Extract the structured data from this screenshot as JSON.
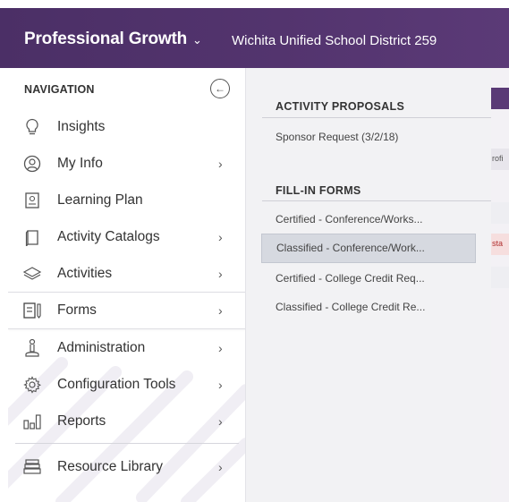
{
  "header": {
    "app_name": "Professional Growth",
    "app_chevron": "⌄",
    "district": "Wichita Unified School District 259"
  },
  "background_fragments": {
    "text1": "rofi",
    "text2": "sta"
  },
  "nav": {
    "heading": "NAVIGATION",
    "collapse_icon": "arrow-left-circle-icon",
    "items": [
      {
        "label": "Insights",
        "icon": "lightbulb-icon",
        "has_submenu": false
      },
      {
        "label": "My Info",
        "icon": "person-circle-icon",
        "has_submenu": true
      },
      {
        "label": "Learning Plan",
        "icon": "id-card-icon",
        "has_submenu": false
      },
      {
        "label": "Activity Catalogs",
        "icon": "catalog-book-icon",
        "has_submenu": true
      },
      {
        "label": "Activities",
        "icon": "layers-icon",
        "has_submenu": true
      },
      {
        "label": "Forms",
        "icon": "form-document-icon",
        "has_submenu": true,
        "active": true
      },
      {
        "label": "Administration",
        "icon": "admin-person-icon",
        "has_submenu": true
      },
      {
        "label": "Configuration Tools",
        "icon": "gear-icon",
        "has_submenu": true
      },
      {
        "label": "Reports",
        "icon": "bar-chart-icon",
        "has_submenu": true
      },
      {
        "label": "Resource Library",
        "icon": "book-stack-icon",
        "has_submenu": true
      }
    ],
    "arrow": "›"
  },
  "submenu": {
    "sections": [
      {
        "title": "ACTIVITY PROPOSALS",
        "items": [
          "Sponsor Request (3/2/18)"
        ]
      },
      {
        "title": "FILL-IN FORMS",
        "items": [
          "Certified - Conference/Workshop Request",
          "Classified - Conference/Workshop Request",
          "Certified - College Credit Request",
          "Classified - College Credit Request"
        ]
      }
    ],
    "display_items": [
      "Sponsor Request (3/2/18)",
      "Certified - Conference/Works...",
      "Classified - Conference/Work...",
      "Certified - College Credit Req...",
      "Classified - College Credit Re..."
    ],
    "highlighted_index": 2
  },
  "colors": {
    "header_bg": "#53346e",
    "submenu_bg": "#f2f2f4",
    "highlight_bg": "#d6d9e0",
    "text": "#333333"
  }
}
